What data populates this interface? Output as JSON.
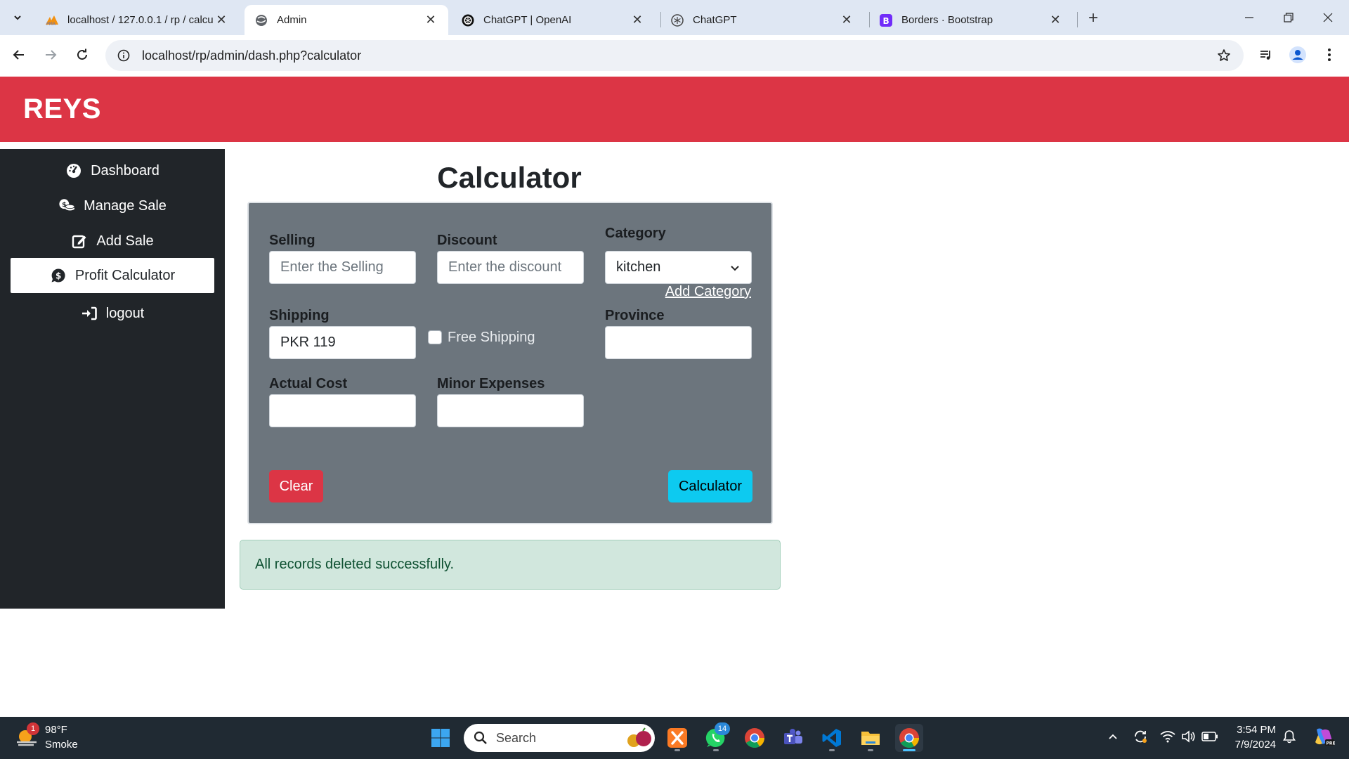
{
  "browser": {
    "tabs": [
      {
        "title": "localhost / 127.0.0.1 / rp / calcu",
        "favicon": "phpmyadmin-icon",
        "active": false
      },
      {
        "title": "Admin",
        "favicon": "globe-icon",
        "active": true
      },
      {
        "title": "ChatGPT | OpenAI",
        "favicon": "openai-icon",
        "active": false
      },
      {
        "title": "ChatGPT",
        "favicon": "openai-icon",
        "active": false
      },
      {
        "title": "Borders · Bootstrap",
        "favicon": "bootstrap-icon",
        "active": false
      }
    ],
    "url": "localhost/rp/admin/dash.php?calculator"
  },
  "site": {
    "brand": "REYS",
    "brand_color": "#dc3545"
  },
  "sidebar": {
    "items": [
      {
        "label": "Dashboard",
        "icon": "gauge-icon"
      },
      {
        "label": "Manage Sale",
        "icon": "coins-icon"
      },
      {
        "label": "Add Sale",
        "icon": "edit-icon"
      },
      {
        "label": "Profit Calculator",
        "icon": "dollar-circle-icon",
        "active": true
      },
      {
        "label": "logout",
        "icon": "sign-in-icon"
      }
    ]
  },
  "calculator": {
    "title": "Calculator",
    "selling": {
      "label": "Selling",
      "placeholder": "Enter the Selling",
      "value": ""
    },
    "discount": {
      "label": "Discount",
      "placeholder": "Enter the discount",
      "value": ""
    },
    "category": {
      "label": "Category",
      "selected": "kitchen",
      "add_link": "Add Category"
    },
    "shipping": {
      "label": "Shipping",
      "value": "PKR 119"
    },
    "free_shipping": {
      "label": "Free Shipping",
      "checked": false
    },
    "province": {
      "label": "Province",
      "value": ""
    },
    "actual_cost": {
      "label": "Actual Cost",
      "value": ""
    },
    "minor_expenses": {
      "label": "Minor Expenses",
      "value": ""
    },
    "clear_button": "Clear",
    "calc_button": "Calculator"
  },
  "alert": {
    "message": "All records deleted successfully."
  },
  "taskbar": {
    "weather_temp": "98°F",
    "weather_desc": "Smoke",
    "weather_badge": "1",
    "search_label": "Search",
    "whatsapp_badge": "14",
    "time": "3:54 PM",
    "date": "7/9/2024"
  }
}
